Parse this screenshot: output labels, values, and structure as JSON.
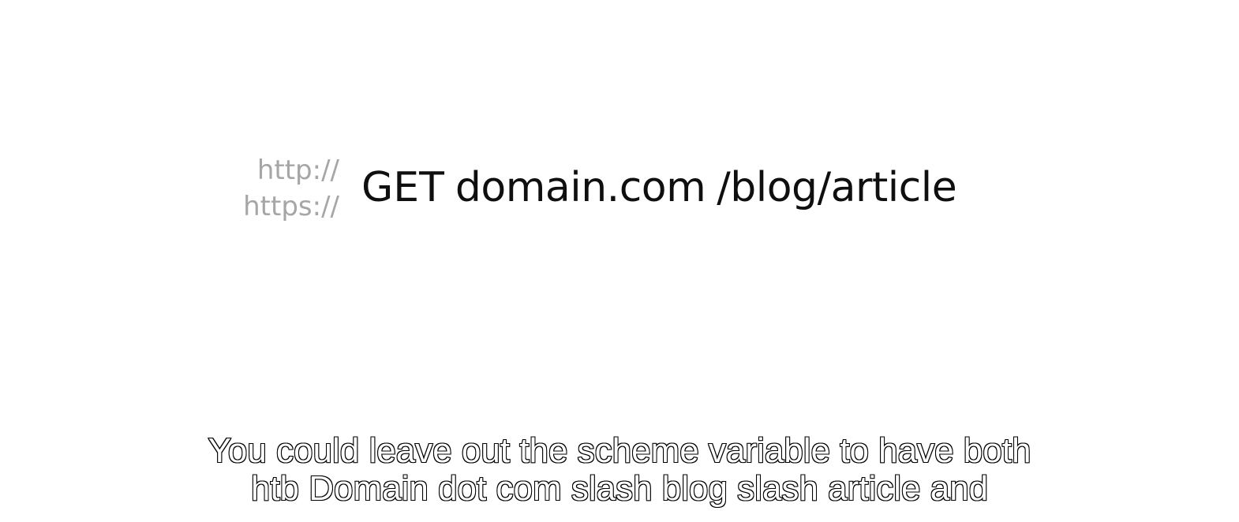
{
  "schemes": {
    "http": "http://",
    "https": "https://"
  },
  "request": {
    "method": "GET",
    "domain": "domain.com",
    "path": "/blog/article"
  },
  "subtitle": {
    "line1": "You could leave out the scheme variable to have both",
    "line2": "htb Domain dot com slash blog slash article and"
  },
  "colors": {
    "scheme_text": "#a6a6a6",
    "url_text": "#0f0f0f",
    "caption_fill": "#ffffff",
    "caption_outline": "#000000",
    "background": "#ffffff"
  }
}
